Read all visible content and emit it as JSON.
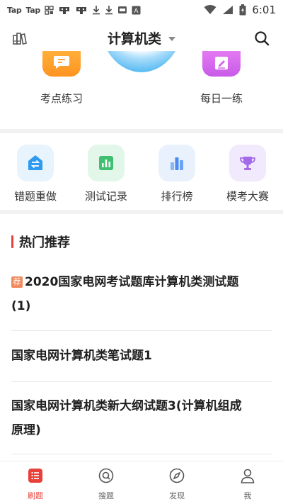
{
  "status_bar": {
    "left_icons": [
      "Tap",
      "Tap",
      "grid-icon",
      "mascot-icon",
      "mascot-icon",
      "download-icon",
      "download-icon",
      "battery-saver-icon",
      "a-box-icon"
    ],
    "time": "6:01"
  },
  "header": {
    "title": "计算机类"
  },
  "features": [
    {
      "label": "考点练习",
      "icon": "chat-icon",
      "color": "#ff9d2a"
    },
    {
      "label": "每日一练",
      "icon": "edit-icon",
      "color": "#d466ee"
    }
  ],
  "quick_actions": [
    {
      "label": "错题重做",
      "icon": "redo-icon",
      "color": "#2e9bf0"
    },
    {
      "label": "测试记录",
      "icon": "bar-chart-icon",
      "color": "#3fbf6f"
    },
    {
      "label": "排行榜",
      "icon": "ranking-icon",
      "color": "#4a8cf2"
    },
    {
      "label": "模考大赛",
      "icon": "trophy-icon",
      "color": "#a36be8"
    }
  ],
  "hot": {
    "title": "热门推荐",
    "badge": "荐",
    "items": [
      {
        "line1": "2020国家电网考试题库计算机类测试题",
        "line2": "(1)"
      },
      {
        "line1": "国家电网计算机类笔试题1",
        "line2": ""
      },
      {
        "line1": "国家电网计算机类新大纲试题3(计算机组成",
        "line2": "原理)"
      }
    ]
  },
  "nav": {
    "items": [
      {
        "label": "刷题",
        "icon": "list-icon",
        "active": true
      },
      {
        "label": "搜题",
        "icon": "search-circle-icon",
        "active": false
      },
      {
        "label": "发现",
        "icon": "compass-icon",
        "active": false
      },
      {
        "label": "我",
        "icon": "user-icon",
        "active": false
      }
    ],
    "active_color": "#e8413a"
  }
}
